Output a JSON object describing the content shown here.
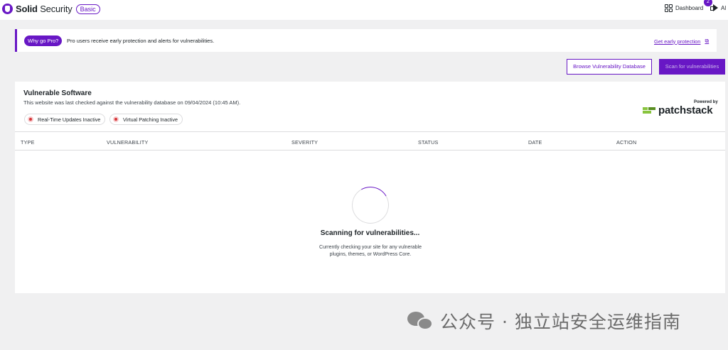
{
  "header": {
    "brand_bold": "Solid",
    "brand_rest": " Security",
    "plan_badge": "Basic",
    "dashboard_label": "Dashboard",
    "notifications_label": "Al",
    "notifications_count": "2"
  },
  "promo": {
    "pill": "Why go Pro?",
    "text": "Pro users receive early protection and alerts for vulnerabilities.",
    "link": "Get early protection"
  },
  "actions": {
    "browse_label": "Browse Vulnerability Database",
    "scan_label": "Scan for vulnerabilities"
  },
  "panel": {
    "title": "Vulnerable Software",
    "subtitle": "This website was last checked against the vulnerability database on 09/04/2024 (10:45 AM).",
    "chips": [
      "Real-Time Updates Inactive",
      "Virtual Patching Inactive"
    ],
    "powered_by": "Powered by",
    "partner": "patchstack"
  },
  "table": {
    "columns": [
      "TYPE",
      "VULNERABILITY",
      "SEVERITY",
      "STATUS",
      "DATE",
      "ACTION"
    ]
  },
  "scan": {
    "title": "Scanning for vulnerabilities...",
    "description": "Currently checking your site for any vulnerable plugins, themes, or WordPress Core."
  },
  "watermark": {
    "text": "公众号 · 独立站安全运维指南"
  },
  "colors": {
    "accent": "#6817c5",
    "background": "#f0f0f1",
    "inactive": "#d63638"
  }
}
